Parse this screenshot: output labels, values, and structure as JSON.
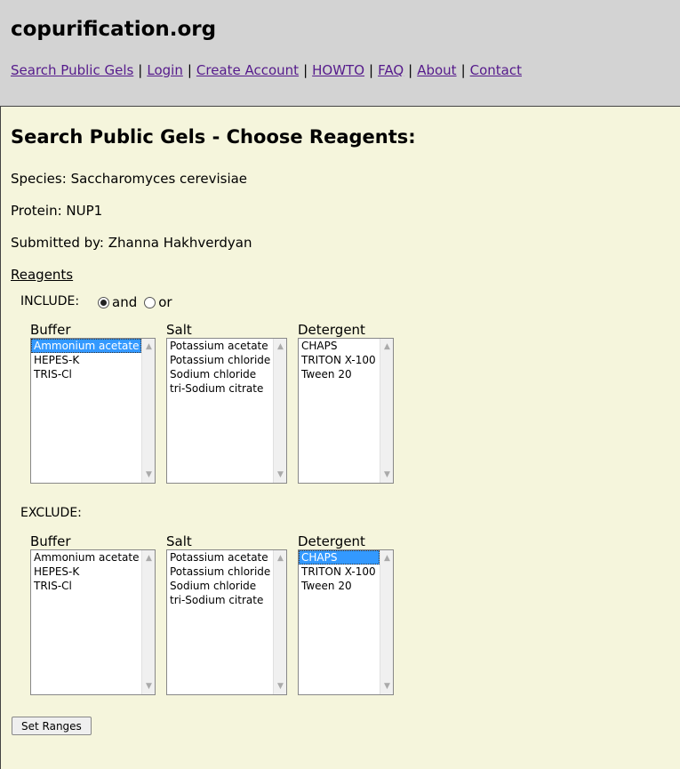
{
  "site": {
    "title": "copurification.org"
  },
  "nav": {
    "links": [
      "Search Public Gels",
      "Login",
      "Create Account",
      "HOWTO",
      "FAQ",
      "About",
      "Contact"
    ],
    "separator": "|"
  },
  "page": {
    "heading": "Search Public Gels - Choose Reagents:",
    "species_label": "Species:",
    "species_value": "Saccharomyces cerevisiae",
    "protein_label": "Protein:",
    "protein_value": "NUP1",
    "submitted_label": "Submitted by:",
    "submitted_value": "Zhanna Hakhverdyan",
    "reagents_label": "Reagents"
  },
  "include": {
    "label": "INCLUDE:",
    "radio_and": "and",
    "radio_or": "or",
    "selected_mode": "and",
    "buffer": {
      "label": "Buffer",
      "options": [
        "Ammonium acetate",
        "HEPES-K",
        "TRIS-Cl"
      ],
      "selected": "Ammonium acetate"
    },
    "salt": {
      "label": "Salt",
      "options": [
        "Potassium acetate",
        "Potassium chloride",
        "Sodium chloride",
        "tri-Sodium citrate"
      ],
      "selected": ""
    },
    "detergent": {
      "label": "Detergent",
      "options": [
        "CHAPS",
        "TRITON X-100",
        "Tween 20"
      ],
      "selected": ""
    }
  },
  "exclude": {
    "label": "EXCLUDE:",
    "buffer": {
      "label": "Buffer",
      "options": [
        "Ammonium acetate",
        "HEPES-K",
        "TRIS-Cl"
      ],
      "selected": ""
    },
    "salt": {
      "label": "Salt",
      "options": [
        "Potassium acetate",
        "Potassium chloride",
        "Sodium chloride",
        "tri-Sodium citrate"
      ],
      "selected": ""
    },
    "detergent": {
      "label": "Detergent",
      "options": [
        "CHAPS",
        "TRITON X-100",
        "Tween 20"
      ],
      "selected": "CHAPS"
    }
  },
  "actions": {
    "set_ranges": "Set Ranges"
  },
  "colors": {
    "header_bg": "#d3d3d3",
    "page_bg": "#f5f5dc",
    "link": "#551a8b",
    "selection": "#3399ff"
  }
}
